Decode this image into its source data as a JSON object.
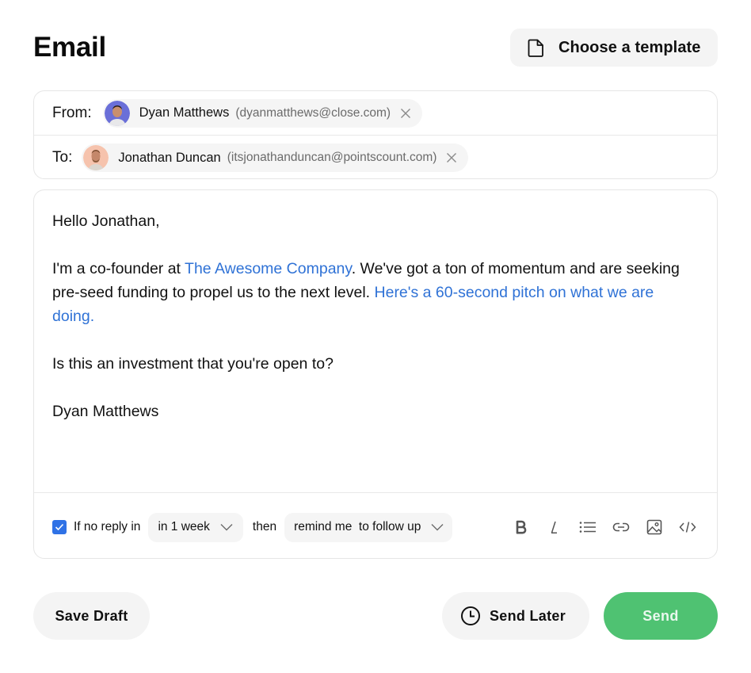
{
  "header": {
    "title": "Email",
    "template_button": {
      "label": "Choose a template",
      "icon": "document-icon"
    }
  },
  "recipients": {
    "from": {
      "label": "From:",
      "name": "Dyan Matthews",
      "email": "(dyanmatthews@close.com)",
      "avatar_bg": "#6a6fd8",
      "remove_icon": "close-icon"
    },
    "to": {
      "label": "To:",
      "name": "Jonathan Duncan",
      "email": "(itsjonathanduncan@pointscount.com)",
      "avatar_bg": "#f6c3ad",
      "remove_icon": "close-icon"
    }
  },
  "body": {
    "greeting": "Hello Jonathan,",
    "p1_start": "I'm a co-founder at ",
    "p1_link": "The Awesome Company",
    "p1_mid": ". We've got a ton of momentum and are seeking pre-seed funding to propel us to the next level. ",
    "p1_link2": "Here's a 60-second pitch on what we are doing.",
    "p2": "Is this an investment that you're open to?",
    "signature": "Dyan Matthews"
  },
  "followup": {
    "checked": true,
    "prefix": "If no reply in",
    "when": "in 1 week",
    "connector": "then",
    "action": "remind me  to follow up"
  },
  "toolbar": {
    "tools": [
      "bold-icon",
      "italic-icon",
      "list-icon",
      "link-icon",
      "image-icon",
      "code-icon"
    ]
  },
  "actions": {
    "save_draft": "Save Draft",
    "send_later": "Send Later",
    "send": "Send"
  },
  "colors": {
    "accent_link": "#2f72d6",
    "send_green": "#4fc272",
    "checkbox_blue": "#2f72e6",
    "button_gray": "#f4f4f4"
  }
}
